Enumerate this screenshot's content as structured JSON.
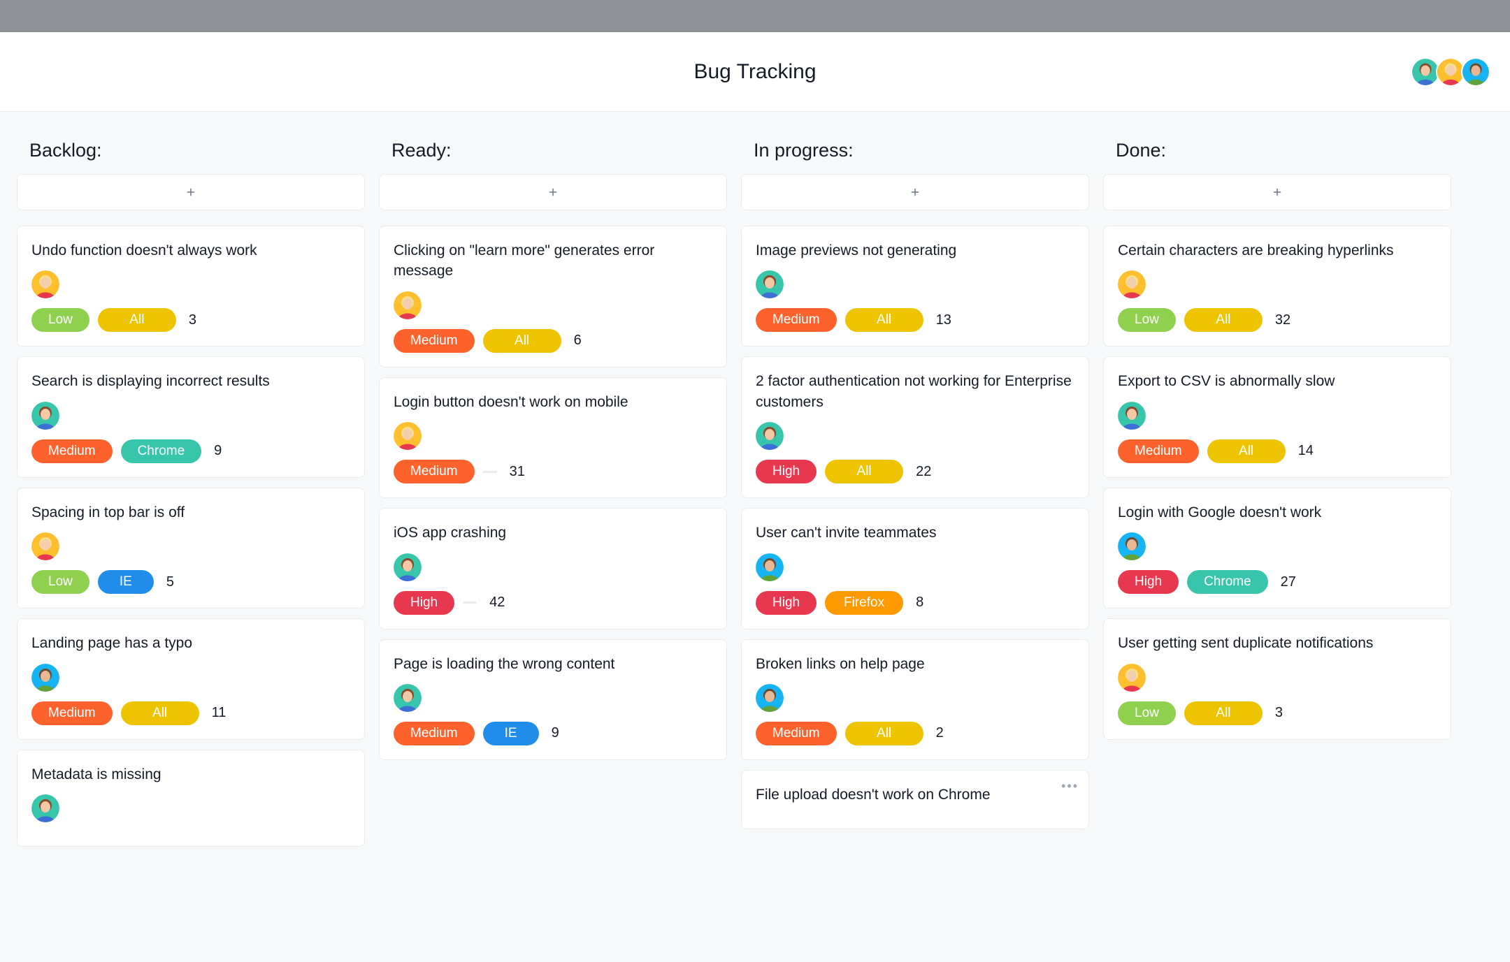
{
  "page_title": "Bug Tracking",
  "team_avatars": [
    "teal-f1",
    "yellow-f2",
    "cyan-m1"
  ],
  "pill_labels": {
    "Low": "Low",
    "Medium": "Medium",
    "High": "High",
    "All": "All",
    "Chrome": "Chrome",
    "IE": "IE",
    "Firefox": "Firefox"
  },
  "pill_colors": {
    "Low": "c-low",
    "Medium": "c-medium",
    "High": "c-high",
    "All": "c-all",
    "Chrome": "c-chrome",
    "IE": "c-ie",
    "Firefox": "c-firefox"
  },
  "avatar_defs": {
    "teal-f1": {
      "bg": "#37c5ab",
      "hair": "#8a4a2c",
      "skin": "#f3c9a5",
      "shirt": "#3b6fd6"
    },
    "yellow-f2": {
      "bg": "#fdbf2d",
      "hair": "#f6e08a",
      "skin": "#f4cfae",
      "shirt": "#e8384f"
    },
    "cyan-m1": {
      "bg": "#16b4f2",
      "hair": "#6a4a30",
      "skin": "#e8b894",
      "shirt": "#61a338"
    }
  },
  "columns": [
    {
      "title": "Backlog:",
      "cards": [
        {
          "title": "Undo function doesn't always work",
          "avatar": "yellow-f2",
          "pills": [
            "Low",
            "All"
          ],
          "count": 3
        },
        {
          "title": "Search is displaying incorrect results",
          "avatar": "teal-f1",
          "pills": [
            "Medium",
            "Chrome"
          ],
          "count": 9
        },
        {
          "title": "Spacing in top bar is off",
          "avatar": "yellow-f2",
          "pills": [
            "Low",
            "IE"
          ],
          "count": 5
        },
        {
          "title": "Landing page has a typo",
          "avatar": "cyan-m1",
          "pills": [
            "Medium",
            "All"
          ],
          "count": 11
        },
        {
          "title": "Metadata is missing",
          "avatar": "teal-f1",
          "pills": [],
          "count": null,
          "partial": true
        }
      ]
    },
    {
      "title": "Ready:",
      "cards": [
        {
          "title": "Clicking on \"learn more\" generates error message",
          "wrap": true,
          "avatar": "yellow-f2",
          "pills": [
            "Medium",
            "All"
          ],
          "count": 6
        },
        {
          "title": "Login button doesn't work on mobile",
          "avatar": "yellow-f2",
          "pills": [
            "Medium",
            "-"
          ],
          "count": 31
        },
        {
          "title": "iOS app crashing",
          "avatar": "teal-f1",
          "pills": [
            "High",
            "-"
          ],
          "count": 42
        },
        {
          "title": "Page is loading the wrong content",
          "avatar": "teal-f1",
          "pills": [
            "Medium",
            "IE"
          ],
          "count": 9
        }
      ]
    },
    {
      "title": "In progress:",
      "cards": [
        {
          "title": "Image previews not generating",
          "avatar": "teal-f1",
          "pills": [
            "Medium",
            "All"
          ],
          "count": 13
        },
        {
          "title": "2 factor authentication not working for Enterprise customers",
          "wrap": true,
          "avatar": "teal-f1",
          "pills": [
            "High",
            "All"
          ],
          "count": 22
        },
        {
          "title": "User can't invite teammates",
          "avatar": "cyan-m1",
          "pills": [
            "High",
            "Firefox"
          ],
          "count": 8
        },
        {
          "title": "Broken links on help page",
          "avatar": "cyan-m1",
          "pills": [
            "Medium",
            "All"
          ],
          "count": 2
        },
        {
          "title": "File upload doesn't work on Chrome",
          "avatar": null,
          "pills": [],
          "count": null,
          "menu": true,
          "partial": true
        }
      ]
    },
    {
      "title": "Done:",
      "cards": [
        {
          "title": "Certain characters are breaking hyperlinks",
          "wrap": true,
          "avatar": "yellow-f2",
          "pills": [
            "Low",
            "All"
          ],
          "count": 32
        },
        {
          "title": "Export to CSV is abnormally slow",
          "avatar": "teal-f1",
          "pills": [
            "Medium",
            "All"
          ],
          "count": 14
        },
        {
          "title": "Login with Google doesn't work",
          "avatar": "cyan-m1",
          "pills": [
            "High",
            "Chrome"
          ],
          "count": 27
        },
        {
          "title": "User getting sent duplicate notifications",
          "avatar": "yellow-f2",
          "pills": [
            "Low",
            "All"
          ],
          "count": 3
        }
      ]
    }
  ]
}
